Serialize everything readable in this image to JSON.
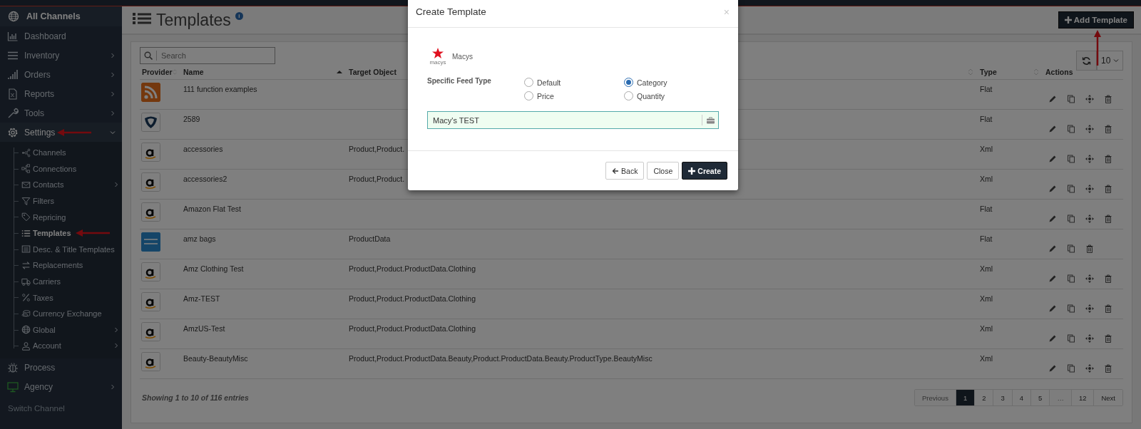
{
  "sidebar": {
    "header": {
      "label": "All Channels"
    },
    "items": [
      {
        "label": "Dashboard",
        "chevron": false,
        "expanded": false,
        "annotated": false
      },
      {
        "label": "Inventory",
        "chevron": true,
        "expanded": false,
        "annotated": false
      },
      {
        "label": "Orders",
        "chevron": true,
        "expanded": false,
        "annotated": false
      },
      {
        "label": "Reports",
        "chevron": true,
        "expanded": false,
        "annotated": false
      },
      {
        "label": "Tools",
        "chevron": true,
        "expanded": false,
        "annotated": false
      },
      {
        "label": "Settings",
        "chevron": true,
        "expanded": true,
        "annotated": true,
        "children": [
          {
            "label": "Channels",
            "chevron": false,
            "selected": false,
            "annotated": false
          },
          {
            "label": "Connections",
            "chevron": false,
            "selected": false,
            "annotated": false
          },
          {
            "label": "Contacts",
            "chevron": true,
            "selected": false,
            "annotated": false
          },
          {
            "label": "Filters",
            "chevron": false,
            "selected": false,
            "annotated": false
          },
          {
            "label": "Repricing",
            "chevron": false,
            "selected": false,
            "annotated": false
          },
          {
            "label": "Templates",
            "chevron": false,
            "selected": true,
            "annotated": true
          },
          {
            "label": "Desc. & Title Templates",
            "chevron": false,
            "selected": false,
            "annotated": false
          },
          {
            "label": "Replacements",
            "chevron": false,
            "selected": false,
            "annotated": false
          },
          {
            "label": "Carriers",
            "chevron": false,
            "selected": false,
            "annotated": false
          },
          {
            "label": "Taxes",
            "chevron": false,
            "selected": false,
            "annotated": false
          },
          {
            "label": "Currency Exchange",
            "chevron": false,
            "selected": false,
            "annotated": false
          },
          {
            "label": "Global",
            "chevron": true,
            "selected": false,
            "annotated": false
          },
          {
            "label": "Account",
            "chevron": true,
            "selected": false,
            "annotated": false
          }
        ]
      },
      {
        "label": "Process",
        "chevron": false,
        "expanded": false,
        "annotated": false
      },
      {
        "label": "Agency",
        "chevron": true,
        "expanded": false,
        "annotated": false
      }
    ],
    "footer": "Switch Channel"
  },
  "page": {
    "title": "Templates",
    "info": "i",
    "add_button": {
      "label": "Add Template",
      "annotated": true
    }
  },
  "table": {
    "search": {
      "placeholder": "Search"
    },
    "page_length": "10",
    "columns": [
      {
        "label": "Provider",
        "kind": "sortable"
      },
      {
        "label": "Name",
        "kind": "sorted"
      },
      {
        "label": "Target Object",
        "kind": "sortable"
      },
      {
        "label": "Type",
        "kind": "sortable"
      },
      {
        "label": "Actions",
        "kind": "plain"
      }
    ],
    "rows": [
      {
        "kind": "rss",
        "name": "111 function examples",
        "target": "",
        "type": "Flat",
        "movable": true
      },
      {
        "kind": "shield",
        "name": "2589",
        "target": "",
        "type": "Flat",
        "movable": true
      },
      {
        "kind": "amazon",
        "name": "accessories",
        "target": "Product,Product.",
        "type": "Xml",
        "movable": true
      },
      {
        "kind": "amazon",
        "name": "accessories2",
        "target": "Product,Product.",
        "type": "Xml",
        "movable": true
      },
      {
        "kind": "amazon",
        "name": "Amazon Flat Test",
        "target": "",
        "type": "Flat",
        "movable": true
      },
      {
        "kind": "generic",
        "name": "amz bags",
        "target": "ProductData",
        "type": "Flat",
        "movable": false
      },
      {
        "kind": "amazon",
        "name": "Amz Clothing Test",
        "target": "Product,Product.ProductData.Clothing",
        "type": "Xml",
        "movable": true
      },
      {
        "kind": "amazon",
        "name": "Amz-TEST",
        "target": "Product,Product.ProductData.Clothing",
        "type": "Xml",
        "movable": true
      },
      {
        "kind": "amazon",
        "name": "AmzUS-Test",
        "target": "Product,Product.ProductData.Clothing",
        "type": "Xml",
        "movable": true
      },
      {
        "kind": "amazon",
        "name": "Beauty-BeautyMisc",
        "target": "Product,Product.ProductData.Beauty,Product.ProductData.Beauty.ProductType.BeautyMisc",
        "type": "Xml",
        "movable": true
      }
    ],
    "info": "Showing 1 to 10 of 116 entries",
    "pagination": [
      {
        "label": "Previous",
        "selected": false,
        "disabled": true
      },
      {
        "label": "1",
        "selected": true,
        "disabled": false
      },
      {
        "label": "2",
        "selected": false,
        "disabled": false
      },
      {
        "label": "3",
        "selected": false,
        "disabled": false
      },
      {
        "label": "4",
        "selected": false,
        "disabled": false
      },
      {
        "label": "5",
        "selected": false,
        "disabled": false
      },
      {
        "label": "…",
        "selected": false,
        "disabled": true
      },
      {
        "label": "12",
        "selected": false,
        "disabled": false
      },
      {
        "label": "Next",
        "selected": false,
        "disabled": false
      }
    ]
  },
  "modal": {
    "title": "Create Template",
    "close": "×",
    "provider": {
      "name": "Macys",
      "logo_text": "macys"
    },
    "feed_type": {
      "label": "Specific Feed Type",
      "options": [
        {
          "label": "Default",
          "selected": false
        },
        {
          "label": "Category",
          "selected": true
        },
        {
          "label": "Price",
          "selected": false
        },
        {
          "label": "Quantity",
          "selected": false
        }
      ]
    },
    "name_value": "Macy's TEST",
    "buttons": [
      {
        "label": "Back",
        "kind": "back"
      },
      {
        "label": "Close",
        "kind": "plain"
      },
      {
        "label": "Create",
        "kind": "primary"
      }
    ]
  }
}
